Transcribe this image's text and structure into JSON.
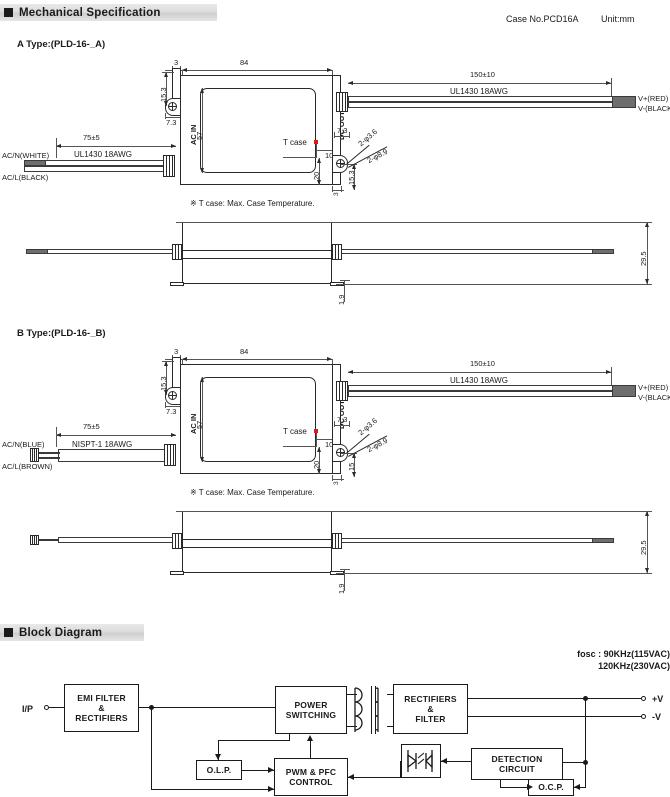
{
  "document": {
    "unit_note": "Unit:mm",
    "case_no": "Case No.PCD16A"
  },
  "sections": [
    {
      "id": "mechanical",
      "title": "Mechanical Specification"
    },
    {
      "id": "block",
      "title": "Block Diagram"
    }
  ],
  "mechanical": {
    "note_tcase": "※ T case: Max. Case Temperature.",
    "variants": [
      {
        "id": "a-type",
        "subtitle": "A Type:(PLD-16-_A)",
        "input_cable": {
          "length": "75±5",
          "spec": "UL1430 18AWG",
          "wire_top": "AC/N(WHITE)",
          "wire_bottom": "AC/L(BLACK)"
        },
        "output_cable": {
          "length": "150±10",
          "spec": "UL1430 18AWG",
          "wire_top": "V+(RED)",
          "wire_bottom": "V-(BLACK)"
        },
        "dimensions": {
          "tab_width": "3",
          "body_length": "84",
          "tab_offset": "15.3",
          "tab_edge": "7.3",
          "body_height": "57",
          "tcase_offset": "10",
          "tcase_down": "20",
          "right_tab_edge": "7.3",
          "right_tab_offset": "15.3",
          "right_tab_width": "3",
          "hole_small": "2-φ3.6",
          "hole_large": "2-φ8.9",
          "side_height": "29.5",
          "side_tab_thickness": "1.9"
        },
        "labels": {
          "ac_in": "AC IN",
          "dc_out": "DC OUT",
          "t_case": "T case"
        }
      },
      {
        "id": "b-type",
        "subtitle": "B Type:(PLD-16-_B)",
        "input_cable": {
          "length": "75±5",
          "spec": "NISPT-1 18AWG",
          "wire_top": "AC/N(BLUE)",
          "wire_bottom": "AC/L(BROWN)"
        },
        "output_cable": {
          "length": "150±10",
          "spec": "UL1430 18AWG",
          "wire_top": "V+(RED)",
          "wire_bottom": "V-(BLACK)"
        },
        "dimensions": {
          "tab_width": "3",
          "body_length": "84",
          "tab_offset": "15.3",
          "tab_edge": "7.3",
          "body_height": "57",
          "tcase_offset": "10",
          "tcase_down": "20",
          "right_tab_edge": "7.3",
          "right_tab_offset": "15",
          "right_tab_width": "3",
          "hole_small": "2-φ3.6",
          "hole_large": "2-φ8.9",
          "side_height": "29.5",
          "side_tab_thickness": "1.9"
        },
        "labels": {
          "ac_in": "AC IN",
          "dc_out": "DC OUT",
          "t_case": "T case"
        }
      }
    ]
  },
  "block_diagram": {
    "fosc_line1": "fosc : 90KHz(115VAC)",
    "fosc_line2": "120KHz(230VAC)",
    "input_terminal": "I/P",
    "output_terminals": [
      "+V",
      "-V"
    ],
    "blocks": [
      {
        "id": "emi",
        "label": "EMI FILTER\n&\nRECTIFIERS"
      },
      {
        "id": "power-sw",
        "label": "POWER\nSWITCHING"
      },
      {
        "id": "rect",
        "label": "RECTIFIERS\n&\nFILTER"
      },
      {
        "id": "olp",
        "label": "O.L.P."
      },
      {
        "id": "pwm",
        "label": "PWM & PFC\nCONTROL"
      },
      {
        "id": "detect",
        "label": "DETECTION\nCIRCUIT"
      },
      {
        "id": "ocp",
        "label": "O.C.P."
      }
    ]
  },
  "colors": {
    "line": "#1a1a1a",
    "tcase_marker": "#e01b14",
    "header_bg": "#dcdcdc",
    "wire_tip": "#6e6e6e"
  }
}
